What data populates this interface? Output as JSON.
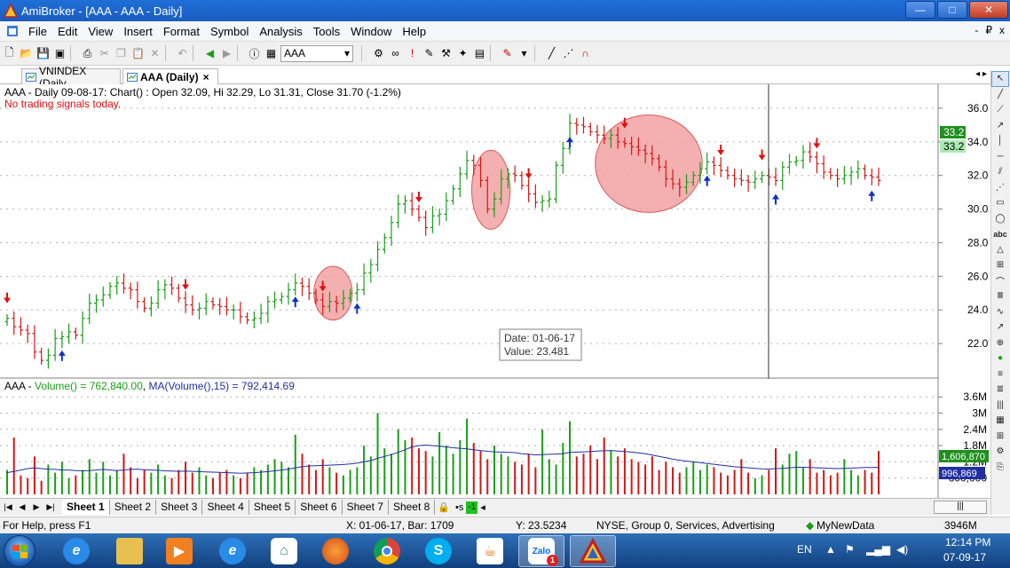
{
  "window": {
    "title": "AmiBroker - [AAA - AAA - Daily]",
    "min": "—",
    "max": "□",
    "close": "✕"
  },
  "menu": [
    "File",
    "Edit",
    "View",
    "Insert",
    "Format",
    "Symbol",
    "Analysis",
    "Tools",
    "Window",
    "Help"
  ],
  "menu_right": [
    "-",
    "₽",
    "x"
  ],
  "toolbar": {
    "symbol": "AAA"
  },
  "doc_tabs": [
    {
      "label": "VNINDEX (Daily"
    },
    {
      "label": "AAA (Daily)",
      "close": "×"
    }
  ],
  "price_panel": {
    "header": "AAA - Daily 09-08-17: Chart() : Open 32.09, Hi 32.29, Lo 31.31, Close 31.70 (-1.2%)",
    "signal_text": "No trading signals today.",
    "y_ticks": [
      "36.0",
      "34.0",
      "32.0",
      "30.0",
      "28.0",
      "26.0",
      "24.0",
      "22.0"
    ],
    "badge_top": "33.2",
    "badge_bottom": "33.2",
    "tooltip": {
      "date": "Date: 01-06-17",
      "value": "Value: 23.481"
    },
    "colors": {
      "up": "#1a9e1a",
      "down": "#d01818",
      "buy_arrow": "#1030c0",
      "sell_arrow": "#e01010",
      "ellipse": "#f3a3a3"
    }
  },
  "volume_panel": {
    "header_prefix": "AAA - ",
    "header_volume": "Volume() = 762,840.00",
    "header_ma": "MA(Volume(),15) = 792,414.69",
    "y_ticks": [
      "3.6M",
      "3M",
      "2.4M",
      "1.8M",
      "1.2M",
      "600,000"
    ],
    "badge_volume": "1,606,870",
    "badge_ma": "996,869"
  },
  "chart_data": [
    {
      "type": "ohlc",
      "title": "AAA - Daily 09-08-17: Chart() : Open 32.09, Hi 32.29, Lo 31.31, Close 31.70 (-1.2%)",
      "ylim": [
        20.0,
        37.0
      ],
      "y_ticks": [
        22,
        24,
        26,
        28,
        30,
        32,
        34,
        36
      ],
      "series": [
        {
          "name": "AAA",
          "close": [
            23.5,
            23.0,
            22.8,
            22.6,
            21.5,
            21.0,
            21.3,
            22.3,
            22.4,
            22.7,
            22.5,
            23.5,
            24.4,
            24.6,
            24.9,
            25.4,
            25.6,
            25.3,
            25.2,
            24.5,
            24.1,
            24.4,
            25.2,
            25.5,
            25.3,
            24.7,
            24.3,
            24.0,
            24.1,
            24.5,
            24.3,
            24.2,
            24.0,
            24.0,
            23.6,
            23.4,
            23.5,
            23.8,
            24.5,
            24.6,
            24.8,
            25.2,
            25.6,
            25.4,
            25.0,
            24.6,
            24.2,
            24.5,
            24.4,
            24.7,
            25.0,
            25.2,
            26.2,
            26.7,
            27.6,
            28.3,
            29.2,
            30.3,
            30.5,
            30.0,
            29.5,
            28.9,
            29.6,
            29.7,
            30.5,
            31.2,
            32.1,
            32.9,
            32.6,
            31.7,
            30.0,
            30.6,
            31.8,
            32.1,
            32.0,
            31.4,
            30.9,
            30.4,
            30.5,
            30.6,
            32.6,
            33.6,
            35.1,
            35.0,
            34.9,
            34.6,
            34.4,
            34.2,
            34.4,
            34.0,
            33.9,
            33.7,
            33.5,
            33.3,
            33.0,
            32.5,
            31.8,
            31.5,
            31.3,
            31.6,
            32.0,
            32.4,
            32.8,
            32.6,
            32.3,
            32.0,
            31.8,
            31.7,
            31.6,
            31.8,
            32.0,
            31.9,
            31.7,
            32.5,
            32.8,
            32.9,
            33.4,
            33.1,
            32.7,
            32.2,
            32.0,
            31.8,
            32.0,
            32.2,
            32.4,
            32.0,
            31.9,
            31.7
          ]
        }
      ],
      "signals": {
        "buy_bar_index": [
          8,
          42,
          51,
          82,
          102,
          112,
          126
        ],
        "sell_bar_index": [
          0,
          26,
          46,
          60,
          76,
          90,
          104,
          110,
          118
        ]
      },
      "highlights": [
        "ellipse around bars 57-59",
        "ellipse around bars 69-72",
        "ellipse around bars 87-101"
      ]
    },
    {
      "type": "bar",
      "title": "AAA - Volume() = 762,840.00, MA(Volume(),15) = 792,414.69",
      "ylim": [
        0,
        4000000
      ],
      "series": [
        {
          "name": "Volume()",
          "values": [
            900000,
            2100000,
            700000,
            600000,
            1400000,
            500000,
            1100000,
            800000,
            1200000,
            600000,
            700000,
            900000,
            1300000,
            800000,
            1200000,
            700000,
            900000,
            1500000,
            1000000,
            600000,
            900000,
            800000,
            1100000,
            700000,
            600000,
            900000,
            1200000,
            800000,
            1000000,
            700000,
            600000,
            800000,
            900000,
            700000,
            600000,
            800000,
            1000000,
            900000,
            1100000,
            1300000,
            1200000,
            1000000,
            2200000,
            1500000,
            1100000,
            900000,
            1300000,
            1000000,
            800000,
            700000,
            900000,
            1000000,
            1800000,
            1400000,
            3000000,
            1700000,
            1500000,
            2400000,
            2000000,
            2100000,
            1700000,
            1600000,
            1400000,
            2300000,
            1800000,
            1500000,
            2000000,
            2800000,
            1900000,
            1600000,
            1300000,
            1800000,
            1500000,
            1400000,
            1200000,
            1100000,
            1500000,
            1000000,
            2400000,
            1300000,
            1100000,
            1900000,
            2700000,
            1400000,
            1500000,
            1800000,
            1300000,
            2100000,
            1600000,
            1400000,
            1700000,
            1300000,
            1200000,
            1100000,
            1400000,
            900000,
            1200000,
            1000000,
            800000,
            1000000,
            1200000,
            900000,
            1100000,
            1000000,
            800000,
            700000,
            900000,
            1300000,
            800000,
            600000,
            700000,
            900000,
            1700000,
            1100000,
            1500000,
            1600000,
            1000000,
            1300000,
            800000,
            900000,
            700000,
            800000,
            1300000,
            900000,
            700000,
            900000,
            800000,
            1600000
          ]
        },
        {
          "name": "MA(Volume(),15)",
          "values": [
            800000,
            850000,
            900000,
            950000,
            980000,
            950000,
            930000,
            920000,
            900000,
            900000,
            880000,
            870000,
            880000,
            900000,
            920000,
            900000,
            880000,
            900000,
            920000,
            930000,
            910000,
            900000,
            890000,
            870000,
            860000,
            850000,
            860000,
            850000,
            840000,
            830000,
            820000,
            810000,
            800000,
            790000,
            780000,
            790000,
            800000,
            820000,
            840000,
            870000,
            900000,
            930000,
            980000,
            1020000,
            1050000,
            1060000,
            1070000,
            1080000,
            1090000,
            1100000,
            1120000,
            1150000,
            1200000,
            1250000,
            1330000,
            1400000,
            1470000,
            1550000,
            1650000,
            1750000,
            1800000,
            1820000,
            1800000,
            1780000,
            1750000,
            1720000,
            1700000,
            1680000,
            1650000,
            1620000,
            1590000,
            1570000,
            1560000,
            1550000,
            1540000,
            1500000,
            1480000,
            1460000,
            1470000,
            1480000,
            1490000,
            1500000,
            1550000,
            1560000,
            1570000,
            1580000,
            1600000,
            1610000,
            1620000,
            1600000,
            1580000,
            1560000,
            1530000,
            1500000,
            1450000,
            1400000,
            1350000,
            1300000,
            1260000,
            1230000,
            1200000,
            1170000,
            1140000,
            1110000,
            1080000,
            1050000,
            1020000,
            1000000,
            980000,
            960000,
            940000,
            930000,
            950000,
            960000,
            980000,
            1000000,
            1000000,
            990000,
            980000,
            970000,
            960000,
            950000,
            960000,
            970000,
            980000,
            990000,
            995000,
            996869
          ]
        }
      ]
    }
  ],
  "sheets": [
    "Sheet 1",
    "Sheet 2",
    "Sheet 3",
    "Sheet 4",
    "Sheet 5",
    "Sheet 6",
    "Sheet 7",
    "Sheet 8"
  ],
  "sheet_extras": {
    "lock": "🔒",
    "s": "•s",
    "green": "-1"
  },
  "status": {
    "help": "For Help, press F1",
    "xinfo": "X: 01-06-17, Bar: 1709",
    "yinfo": "Y: 23.5234",
    "exchange": "NYSE, Group 0, Services, Advertising",
    "database": "MyNewData",
    "memory": "3946M"
  },
  "taskbar": {
    "lang": "EN",
    "time": "12:14 PM",
    "date": "07-09-17",
    "zalo_badge": "1",
    "zalo_label": "Zalo"
  }
}
